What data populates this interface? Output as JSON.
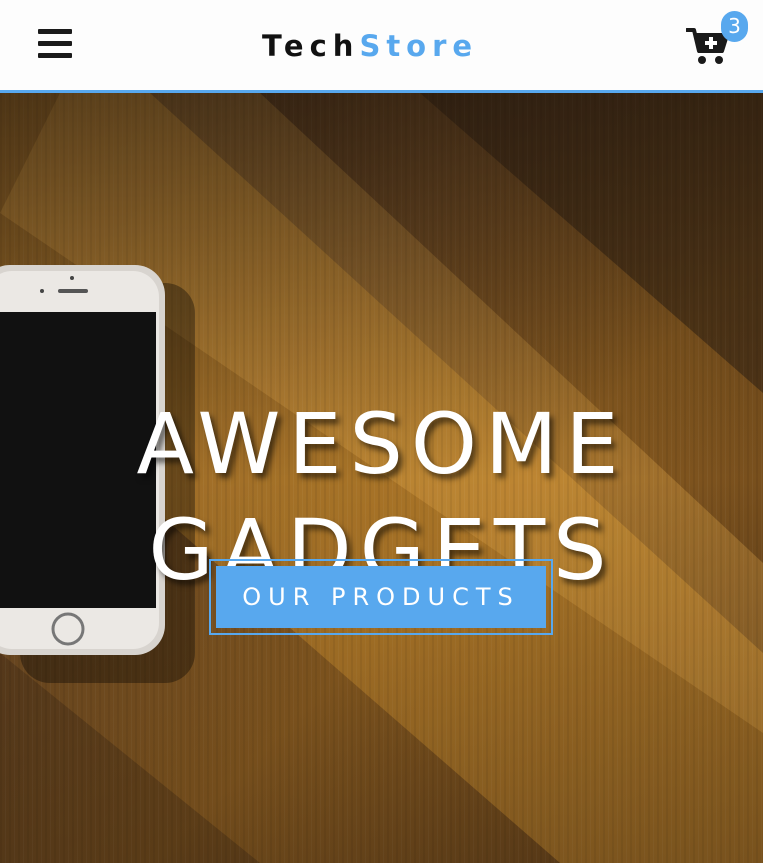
{
  "header": {
    "menu_icon": "hamburger-menu-icon",
    "brand": {
      "part_a": "Tech",
      "part_b": "Store"
    },
    "cart_icon": "cart-plus-icon",
    "cart_count": "3"
  },
  "hero": {
    "title_line_1": "AWESOME",
    "title_line_2": "GADGETS",
    "cta_label": "OUR PRODUCTS"
  },
  "colors": {
    "accent": "#58a8ee",
    "nav_background": "#fdfdfd",
    "brand_dark": "#111111",
    "hero_text": "#ffffff"
  }
}
